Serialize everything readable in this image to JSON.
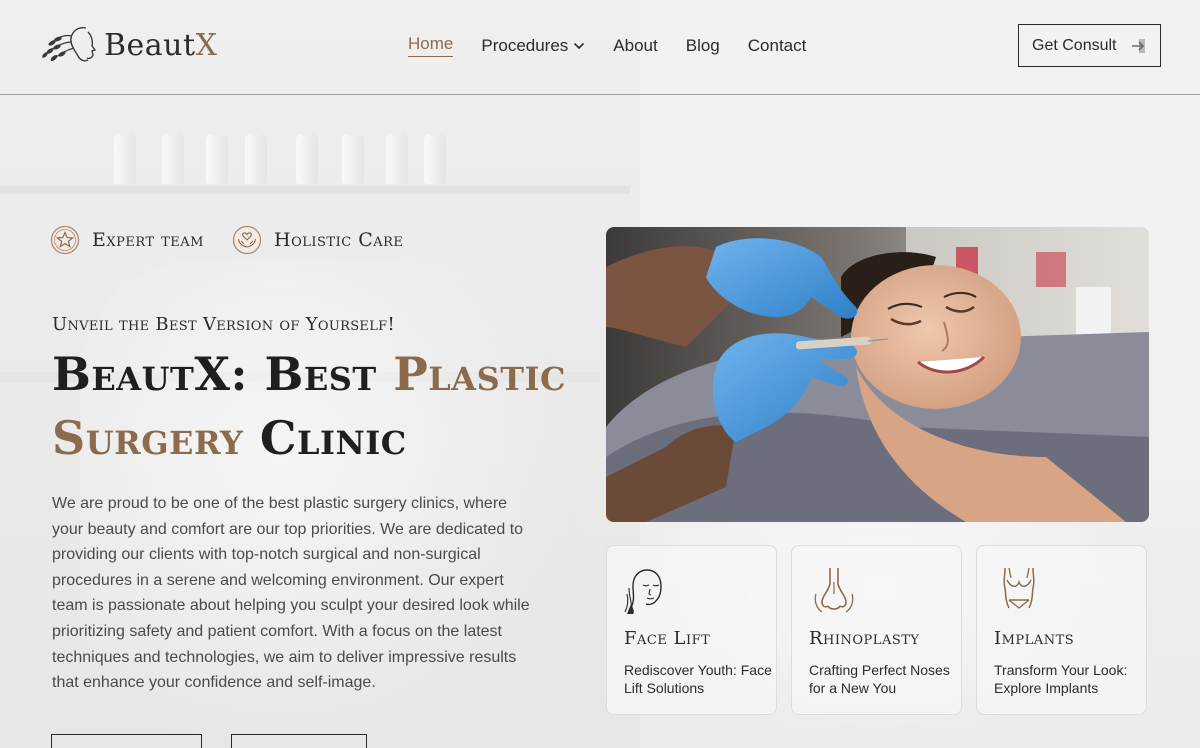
{
  "brand": {
    "name_main": "Beaut",
    "name_accent": "X"
  },
  "nav": {
    "items": [
      {
        "label": "Home",
        "active": true
      },
      {
        "label": "Procedures",
        "has_dropdown": true
      },
      {
        "label": "About"
      },
      {
        "label": "Blog"
      },
      {
        "label": "Contact"
      }
    ],
    "cta_label": "Get Consult"
  },
  "features": [
    {
      "label": "Expert team",
      "icon": "star-badge-icon"
    },
    {
      "label": "Holistic Care",
      "icon": "heart-hands-icon"
    }
  ],
  "hero": {
    "eyebrow": "Unveil the Best Version of Yourself!",
    "headline_part1": "BeautX: Best ",
    "headline_accent": "Plastic Surgery",
    "headline_part2": " Clinic",
    "description": "We are proud to be one of the best plastic surgery clinics, where your beauty and comfort are our top priorities. We are dedicated to providing our clients with top-notch surgical and non-surgical procedures in a serene and welcoming environment. Our expert team is passionate about helping you sculpt your desired look while prioritizing safety and patient comfort. With a focus on the latest techniques and technologies, we aim to deliver impressive results that enhance your confidence and self-image."
  },
  "procedures": [
    {
      "title": "Face Lift",
      "text": "Rediscover Youth: Face Lift Solutions",
      "icon": "face-profile-icon"
    },
    {
      "title": "Rhinoplasty",
      "text": "Crafting Perfect Noses for a New You",
      "icon": "nose-icon"
    },
    {
      "title": "Implants",
      "text": "Transform Your Look: Explore Implants",
      "icon": "torso-icon"
    }
  ],
  "colors": {
    "accent": "#8b6b4c",
    "text": "#2b2b2b",
    "glove": "#4a97d9"
  }
}
